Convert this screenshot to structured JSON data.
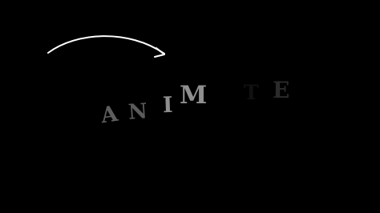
{
  "letters": [
    {
      "char": "A",
      "color": "#5e5e5e"
    },
    {
      "char": "N",
      "color": "#5b5b5b"
    },
    {
      "char": "I",
      "color": "#8e8e8e"
    },
    {
      "char": "M",
      "color": "#8f8f8f"
    },
    {
      "char": "T",
      "color": "#111111"
    },
    {
      "char": "E",
      "color": "#2b2b2b"
    }
  ],
  "arrow": {
    "color": "#ffffff"
  }
}
